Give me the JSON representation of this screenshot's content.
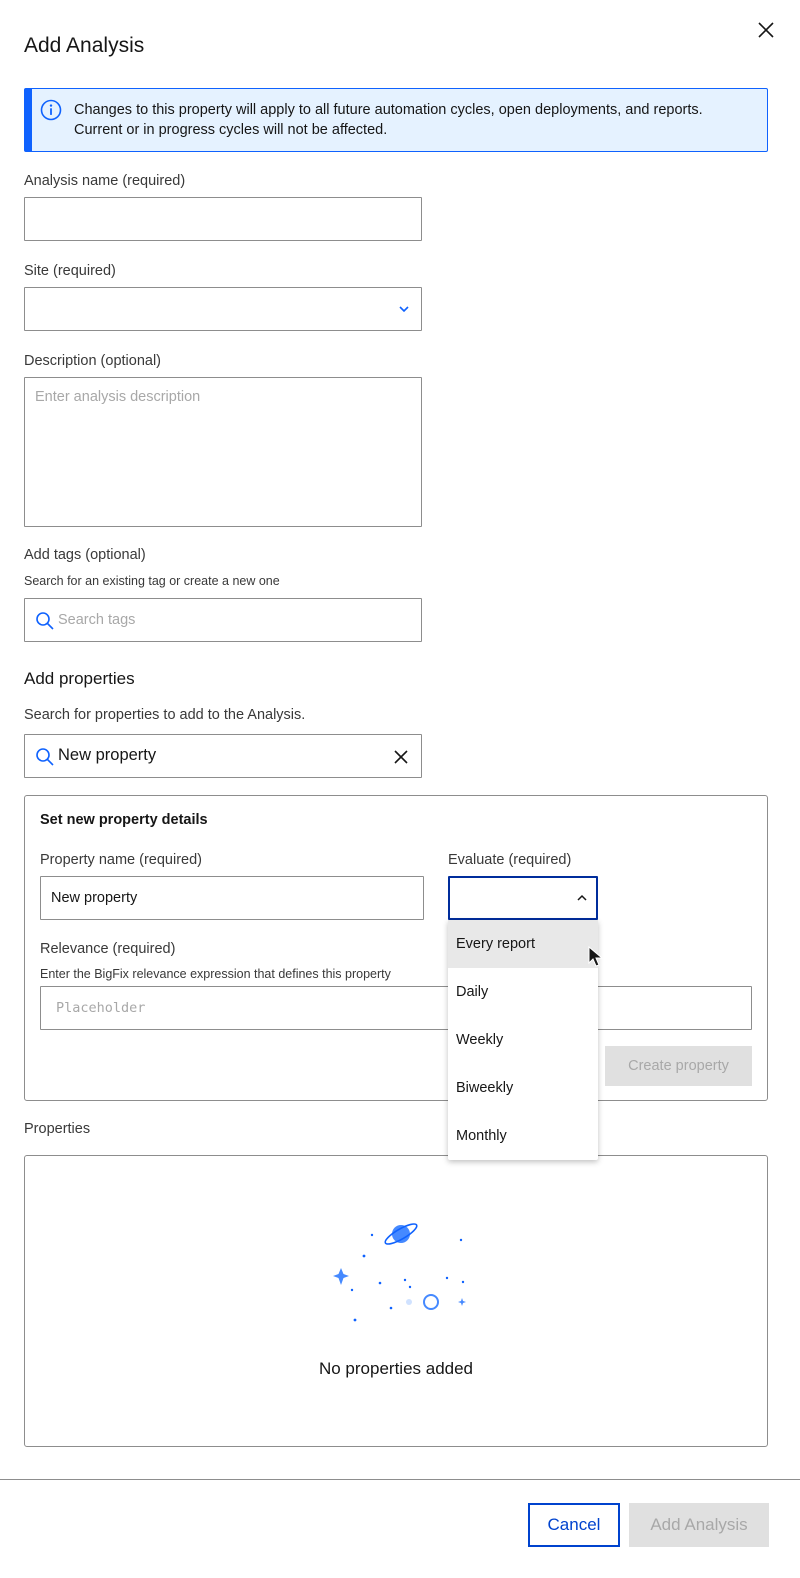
{
  "modal": {
    "title": "Add Analysis"
  },
  "banner": {
    "line1": "Changes to this property will apply to all future automation cycles, open deployments, and reports.",
    "line2": "Current or in progress cycles will not be affected."
  },
  "form": {
    "analysis_name_label": "Analysis name (required)",
    "analysis_name_value": "",
    "site_label": "Site (required)",
    "site_value": "",
    "description_label": "Description (optional)",
    "description_placeholder": "Enter analysis description",
    "tags_label": "Add tags (optional)",
    "tags_helper": "Search for an existing tag or create a new one",
    "tags_placeholder": "Search tags"
  },
  "add_properties": {
    "title": "Add properties",
    "helper": "Search for properties to add to the Analysis.",
    "search_value": "New property"
  },
  "new_property": {
    "title": "Set new property details",
    "name_label": "Property name (required)",
    "name_value": "New property",
    "evaluate_label": "Evaluate (required)",
    "evaluate_value": "",
    "relevance_label": "Relevance (required)",
    "relevance_helper": "Enter the BigFix relevance expression that defines this property",
    "relevance_placeholder": "Placeholder",
    "create_button": "Create property"
  },
  "evaluate_options": [
    "Every report",
    "Daily",
    "Weekly",
    "Biweekly",
    "Monthly"
  ],
  "properties": {
    "title": "Properties",
    "empty_text": "No properties added"
  },
  "footer": {
    "cancel": "Cancel",
    "add": "Add Analysis"
  },
  "colors": {
    "accent": "#0f62fe",
    "banner_bg": "#e5f2ff",
    "focus_border": "#002d9c",
    "disabled_bg": "#e0e0e0"
  }
}
